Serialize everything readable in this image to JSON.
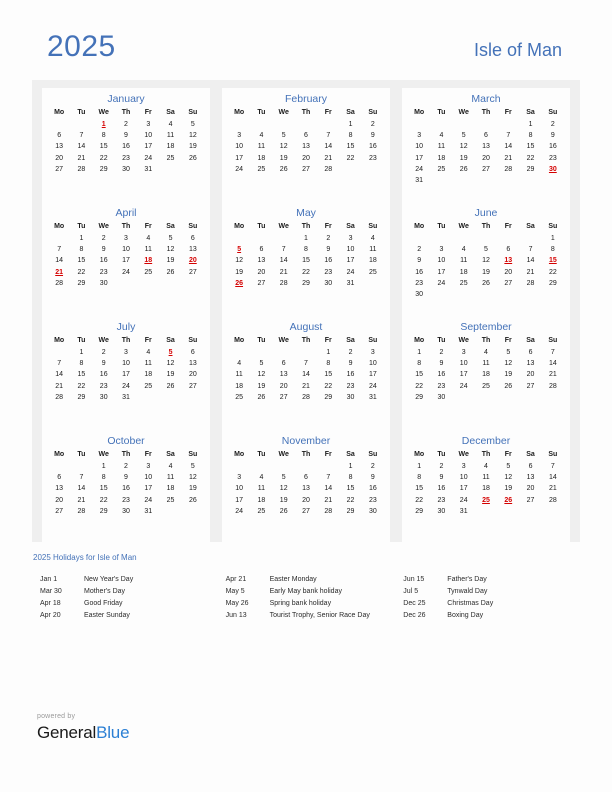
{
  "header": {
    "year": "2025",
    "country": "Isle of Man"
  },
  "colors": {
    "accent_blue": "#4472b8",
    "holiday_red": "#d40000",
    "band_gray": "#efefef",
    "logo_blue": "#2b7fd4"
  },
  "weekday_headers": [
    "Mo",
    "Tu",
    "We",
    "Th",
    "Fr",
    "Sa",
    "Su"
  ],
  "months": [
    {
      "name": "January",
      "weeks": [
        [
          "",
          "",
          "1",
          "2",
          "3",
          "4",
          "5"
        ],
        [
          "6",
          "7",
          "8",
          "9",
          "10",
          "11",
          "12"
        ],
        [
          "13",
          "14",
          "15",
          "16",
          "17",
          "18",
          "19"
        ],
        [
          "20",
          "21",
          "22",
          "23",
          "24",
          "25",
          "26"
        ],
        [
          "27",
          "28",
          "29",
          "30",
          "31",
          "",
          ""
        ]
      ],
      "holidays": [
        "1"
      ]
    },
    {
      "name": "February",
      "weeks": [
        [
          "",
          "",
          "",
          "",
          "",
          "1",
          "2"
        ],
        [
          "3",
          "4",
          "5",
          "6",
          "7",
          "8",
          "9"
        ],
        [
          "10",
          "11",
          "12",
          "13",
          "14",
          "15",
          "16"
        ],
        [
          "17",
          "18",
          "19",
          "20",
          "21",
          "22",
          "23"
        ],
        [
          "24",
          "25",
          "26",
          "27",
          "28",
          "",
          ""
        ]
      ],
      "holidays": []
    },
    {
      "name": "March",
      "weeks": [
        [
          "",
          "",
          "",
          "",
          "",
          "1",
          "2"
        ],
        [
          "3",
          "4",
          "5",
          "6",
          "7",
          "8",
          "9"
        ],
        [
          "10",
          "11",
          "12",
          "13",
          "14",
          "15",
          "16"
        ],
        [
          "17",
          "18",
          "19",
          "20",
          "21",
          "22",
          "23"
        ],
        [
          "24",
          "25",
          "26",
          "27",
          "28",
          "29",
          "30"
        ],
        [
          "31",
          "",
          "",
          "",
          "",
          "",
          ""
        ]
      ],
      "holidays": [
        "30"
      ]
    },
    {
      "name": "April",
      "weeks": [
        [
          "",
          "1",
          "2",
          "3",
          "4",
          "5",
          "6"
        ],
        [
          "7",
          "8",
          "9",
          "10",
          "11",
          "12",
          "13"
        ],
        [
          "14",
          "15",
          "16",
          "17",
          "18",
          "19",
          "20"
        ],
        [
          "21",
          "22",
          "23",
          "24",
          "25",
          "26",
          "27"
        ],
        [
          "28",
          "29",
          "30",
          "",
          "",
          "",
          ""
        ]
      ],
      "holidays": [
        "18",
        "20",
        "21"
      ]
    },
    {
      "name": "May",
      "weeks": [
        [
          "",
          "",
          "",
          "1",
          "2",
          "3",
          "4"
        ],
        [
          "5",
          "6",
          "7",
          "8",
          "9",
          "10",
          "11"
        ],
        [
          "12",
          "13",
          "14",
          "15",
          "16",
          "17",
          "18"
        ],
        [
          "19",
          "20",
          "21",
          "22",
          "23",
          "24",
          "25"
        ],
        [
          "26",
          "27",
          "28",
          "29",
          "30",
          "31",
          ""
        ]
      ],
      "holidays": [
        "5",
        "26"
      ]
    },
    {
      "name": "June",
      "weeks": [
        [
          "",
          "",
          "",
          "",
          "",
          "",
          "1"
        ],
        [
          "2",
          "3",
          "4",
          "5",
          "6",
          "7",
          "8"
        ],
        [
          "9",
          "10",
          "11",
          "12",
          "13",
          "14",
          "15"
        ],
        [
          "16",
          "17",
          "18",
          "19",
          "20",
          "21",
          "22"
        ],
        [
          "23",
          "24",
          "25",
          "26",
          "27",
          "28",
          "29"
        ],
        [
          "30",
          "",
          "",
          "",
          "",
          "",
          ""
        ]
      ],
      "holidays": [
        "13",
        "15"
      ]
    },
    {
      "name": "July",
      "weeks": [
        [
          "",
          "1",
          "2",
          "3",
          "4",
          "5",
          "6"
        ],
        [
          "7",
          "8",
          "9",
          "10",
          "11",
          "12",
          "13"
        ],
        [
          "14",
          "15",
          "16",
          "17",
          "18",
          "19",
          "20"
        ],
        [
          "21",
          "22",
          "23",
          "24",
          "25",
          "26",
          "27"
        ],
        [
          "28",
          "29",
          "30",
          "31",
          "",
          "",
          ""
        ]
      ],
      "holidays": [
        "5"
      ]
    },
    {
      "name": "August",
      "weeks": [
        [
          "",
          "",
          "",
          "",
          "1",
          "2",
          "3"
        ],
        [
          "4",
          "5",
          "6",
          "7",
          "8",
          "9",
          "10"
        ],
        [
          "11",
          "12",
          "13",
          "14",
          "15",
          "16",
          "17"
        ],
        [
          "18",
          "19",
          "20",
          "21",
          "22",
          "23",
          "24"
        ],
        [
          "25",
          "26",
          "27",
          "28",
          "29",
          "30",
          "31"
        ]
      ],
      "holidays": []
    },
    {
      "name": "September",
      "weeks": [
        [
          "1",
          "2",
          "3",
          "4",
          "5",
          "6",
          "7"
        ],
        [
          "8",
          "9",
          "10",
          "11",
          "12",
          "13",
          "14"
        ],
        [
          "15",
          "16",
          "17",
          "18",
          "19",
          "20",
          "21"
        ],
        [
          "22",
          "23",
          "24",
          "25",
          "26",
          "27",
          "28"
        ],
        [
          "29",
          "30",
          "",
          "",
          "",
          "",
          ""
        ]
      ],
      "holidays": []
    },
    {
      "name": "October",
      "weeks": [
        [
          "",
          "",
          "1",
          "2",
          "3",
          "4",
          "5"
        ],
        [
          "6",
          "7",
          "8",
          "9",
          "10",
          "11",
          "12"
        ],
        [
          "13",
          "14",
          "15",
          "16",
          "17",
          "18",
          "19"
        ],
        [
          "20",
          "21",
          "22",
          "23",
          "24",
          "25",
          "26"
        ],
        [
          "27",
          "28",
          "29",
          "30",
          "31",
          "",
          ""
        ]
      ],
      "holidays": []
    },
    {
      "name": "November",
      "weeks": [
        [
          "",
          "",
          "",
          "",
          "",
          "1",
          "2"
        ],
        [
          "3",
          "4",
          "5",
          "6",
          "7",
          "8",
          "9"
        ],
        [
          "10",
          "11",
          "12",
          "13",
          "14",
          "15",
          "16"
        ],
        [
          "17",
          "18",
          "19",
          "20",
          "21",
          "22",
          "23"
        ],
        [
          "24",
          "25",
          "26",
          "27",
          "28",
          "29",
          "30"
        ]
      ],
      "holidays": []
    },
    {
      "name": "December",
      "weeks": [
        [
          "1",
          "2",
          "3",
          "4",
          "5",
          "6",
          "7"
        ],
        [
          "8",
          "9",
          "10",
          "11",
          "12",
          "13",
          "14"
        ],
        [
          "15",
          "16",
          "17",
          "18",
          "19",
          "20",
          "21"
        ],
        [
          "22",
          "23",
          "24",
          "25",
          "26",
          "27",
          "28"
        ],
        [
          "29",
          "30",
          "31",
          "",
          "",
          "",
          ""
        ]
      ],
      "holidays": [
        "25",
        "26"
      ]
    }
  ],
  "legend": {
    "title": "2025 Holidays for Isle of Man",
    "columns": [
      [
        {
          "date": "Jan 1",
          "name": "New Year's Day"
        },
        {
          "date": "Mar 30",
          "name": "Mother's Day"
        },
        {
          "date": "Apr 18",
          "name": "Good Friday"
        },
        {
          "date": "Apr 20",
          "name": "Easter Sunday"
        }
      ],
      [
        {
          "date": "Apr 21",
          "name": "Easter Monday"
        },
        {
          "date": "May 5",
          "name": "Early May bank holiday"
        },
        {
          "date": "May 26",
          "name": "Spring bank holiday"
        },
        {
          "date": "Jun 13",
          "name": "Tourist Trophy, Senior Race Day"
        }
      ],
      [
        {
          "date": "Jun 15",
          "name": "Father's Day"
        },
        {
          "date": "Jul 5",
          "name": "Tynwald Day"
        },
        {
          "date": "Dec 25",
          "name": "Christmas Day"
        },
        {
          "date": "Dec 26",
          "name": "Boxing Day"
        }
      ]
    ]
  },
  "footer": {
    "powered_by": "powered by",
    "logo_part1": "General",
    "logo_part2": "Blue"
  }
}
